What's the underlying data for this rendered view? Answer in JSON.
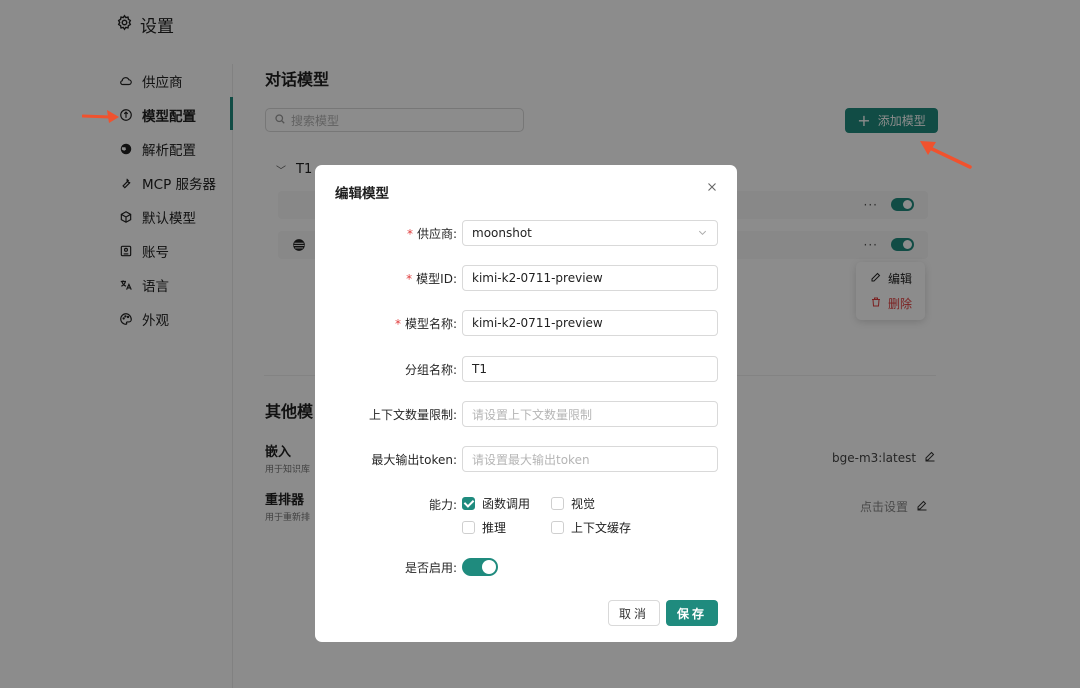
{
  "header": {
    "title": "设置",
    "icon": "gear-icon"
  },
  "sidebar": {
    "items": [
      {
        "label": "供应商",
        "icon": "cloud-icon"
      },
      {
        "label": "模型配置",
        "icon": "model-icon",
        "active": true
      },
      {
        "label": "解析配置",
        "icon": "globe-icon"
      },
      {
        "label": "MCP 服务器",
        "icon": "wrench-icon"
      },
      {
        "label": "默认模型",
        "icon": "cube-icon"
      },
      {
        "label": "账号",
        "icon": "id-card-icon"
      },
      {
        "label": "语言",
        "icon": "translate-icon"
      },
      {
        "label": "外观",
        "icon": "palette-icon"
      }
    ]
  },
  "main": {
    "section_title": "对话模型",
    "search_placeholder": "搜索模型",
    "add_button": "添加模型",
    "group_name": "T1",
    "context_menu": {
      "edit": "编辑",
      "delete": "删除"
    },
    "other_title": "其他模",
    "embed": {
      "label": "嵌入",
      "desc": "用于知识库",
      "value": "bge-m3:latest"
    },
    "rerank": {
      "label": "重排器",
      "desc": "用于重新排",
      "value": "点击设置"
    }
  },
  "modal": {
    "title": "编辑模型",
    "fields": {
      "provider": {
        "label": "供应商:",
        "value": "moonshot",
        "required": true
      },
      "model_id": {
        "label": "模型ID:",
        "value": "kimi-k2-0711-preview",
        "required": true
      },
      "model_name": {
        "label": "模型名称:",
        "value": "kimi-k2-0711-preview",
        "required": true
      },
      "group_name": {
        "label": "分组名称:",
        "value": "T1"
      },
      "context_limit": {
        "label": "上下文数量限制:",
        "placeholder": "请设置上下文数量限制"
      },
      "max_output": {
        "label": "最大输出token:",
        "placeholder": "请设置最大输出token"
      }
    },
    "capabilities": {
      "label": "能力:",
      "function_call": {
        "label": "函数调用",
        "checked": true
      },
      "vision": {
        "label": "视觉",
        "checked": false
      },
      "reasoning": {
        "label": "推理",
        "checked": false
      },
      "context_cache": {
        "label": "上下文缓存",
        "checked": false
      }
    },
    "enabled": {
      "label": "是否启用:",
      "on": true
    },
    "cancel": "取消",
    "save": "保存"
  },
  "colors": {
    "accent": "#1f8b7e",
    "danger": "#e03b3b",
    "arrow": "#f0522e"
  }
}
